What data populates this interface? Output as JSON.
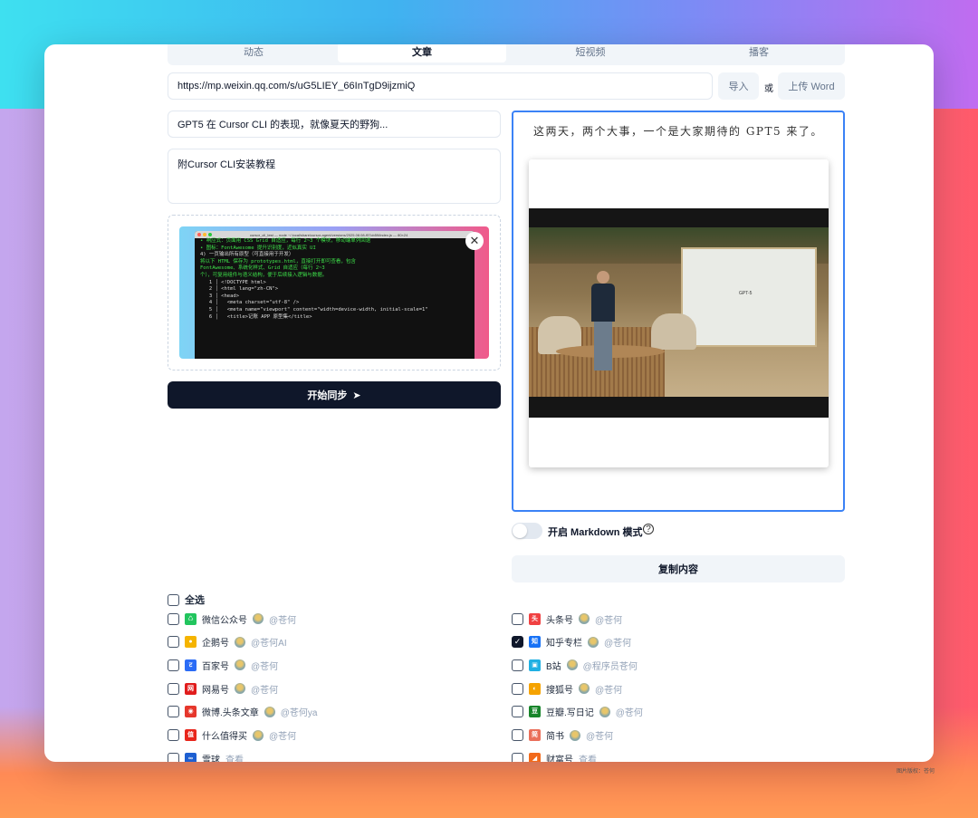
{
  "tabs": [
    "动态",
    "文章",
    "短视频",
    "播客"
  ],
  "url_input": "https://mp.weixin.qq.com/s/uG5LIEY_66InTgD9ijzmiQ",
  "import_button": "导入",
  "or_label": "或",
  "upload_word_button": "上传 Word",
  "title_input": "GPT5 在 Cursor CLI 的表现，就像夏天的野狗...",
  "summary_input": "附Cursor CLI安装教程",
  "cover": {
    "terminal_title": "cursor_cli_test — node ~/.local/share/cursor-agent/versions/2025.08.08-f57cb59/index.js — 80×24",
    "lines": [
      "• 响应式：页面用 CSS Grid 自适应，每行 2~3 个模块，移动端单列回退",
      "• 图标：FontAwesome 提升识别度，近似真实 UI",
      "",
      "4) 一页输出所有原型（可直接用于开发）",
      "",
      "将以下 HTML 保存为 prototypes.html，直接打开即可查看，包含",
      "FontAwesome、系统化样式、Grid 自适应（每行 2~3",
      "个），可复用组件与语义结构，便于后续接入逻辑与数据。",
      "",
      "   1 │ <!DOCTYPE html>",
      "   2 │ <html lang=\"zh-CN\">",
      "   3 │ <head>",
      "   4 │   <meta charset=\"utf-8\" />",
      "   5 │   <meta name=\"viewport\" content=\"width=device-width, initial-scale=1\"",
      "",
      "   6 │   <title>记账 APP 原型集</title>"
    ]
  },
  "sync_button": "开始同步",
  "editor": {
    "paragraph": "这两天，两个大事，一个是大家期待的 GPT5 来了。",
    "video_slide_text": "GPT-5"
  },
  "markdown_toggle": {
    "label": "开启 Markdown 模式",
    "on": false
  },
  "copy_button": "复制内容",
  "select_all": "全选",
  "platforms_left": [
    {
      "name": "微信公众号",
      "account": "@苍何",
      "icon": "♺",
      "color": "#22c55e",
      "checked": false
    },
    {
      "name": "企鹅号",
      "account": "@苍何AI",
      "icon": "●",
      "color": "#f5b400",
      "checked": false
    },
    {
      "name": "百家号",
      "account": "@苍何",
      "icon": "ट",
      "color": "#2b6cf6",
      "checked": false
    },
    {
      "name": "网易号",
      "account": "@苍何",
      "icon": "网易",
      "color": "#e11d1d",
      "checked": false
    },
    {
      "name": "微博.头条文章",
      "account": "@苍何ya",
      "icon": "◉",
      "color": "#e6372c",
      "checked": false
    },
    {
      "name": "什么值得买",
      "account": "@苍何",
      "icon": "值",
      "color": "#e8261c",
      "checked": false
    },
    {
      "name": "雪球",
      "account": "查看",
      "icon": "∞",
      "color": "#1d5fd1",
      "checked": false
    }
  ],
  "platforms_right": [
    {
      "name": "头条号",
      "account": "@苍何",
      "icon": "头条",
      "color": "#f04142",
      "checked": false
    },
    {
      "name": "知乎专栏",
      "account": "@苍何",
      "icon": "知",
      "color": "#1772f6",
      "checked": true
    },
    {
      "name": "B站",
      "account": "@程序员苍何",
      "icon": "▣",
      "color": "#20b0e3",
      "checked": false
    },
    {
      "name": "搜狐号",
      "account": "@苍何",
      "icon": "◐",
      "color": "#f5a300",
      "checked": false
    },
    {
      "name": "豆瓣.写日记",
      "account": "@苍何",
      "icon": "豆",
      "color": "#17852a",
      "checked": false
    },
    {
      "name": "简书",
      "account": "@苍何",
      "icon": "简",
      "color": "#ea6f5a",
      "checked": false
    },
    {
      "name": "财富号",
      "account": "查看",
      "icon": "◢",
      "color": "#f26a1b",
      "checked": false
    }
  ],
  "watermark": "图片版权：苍何"
}
